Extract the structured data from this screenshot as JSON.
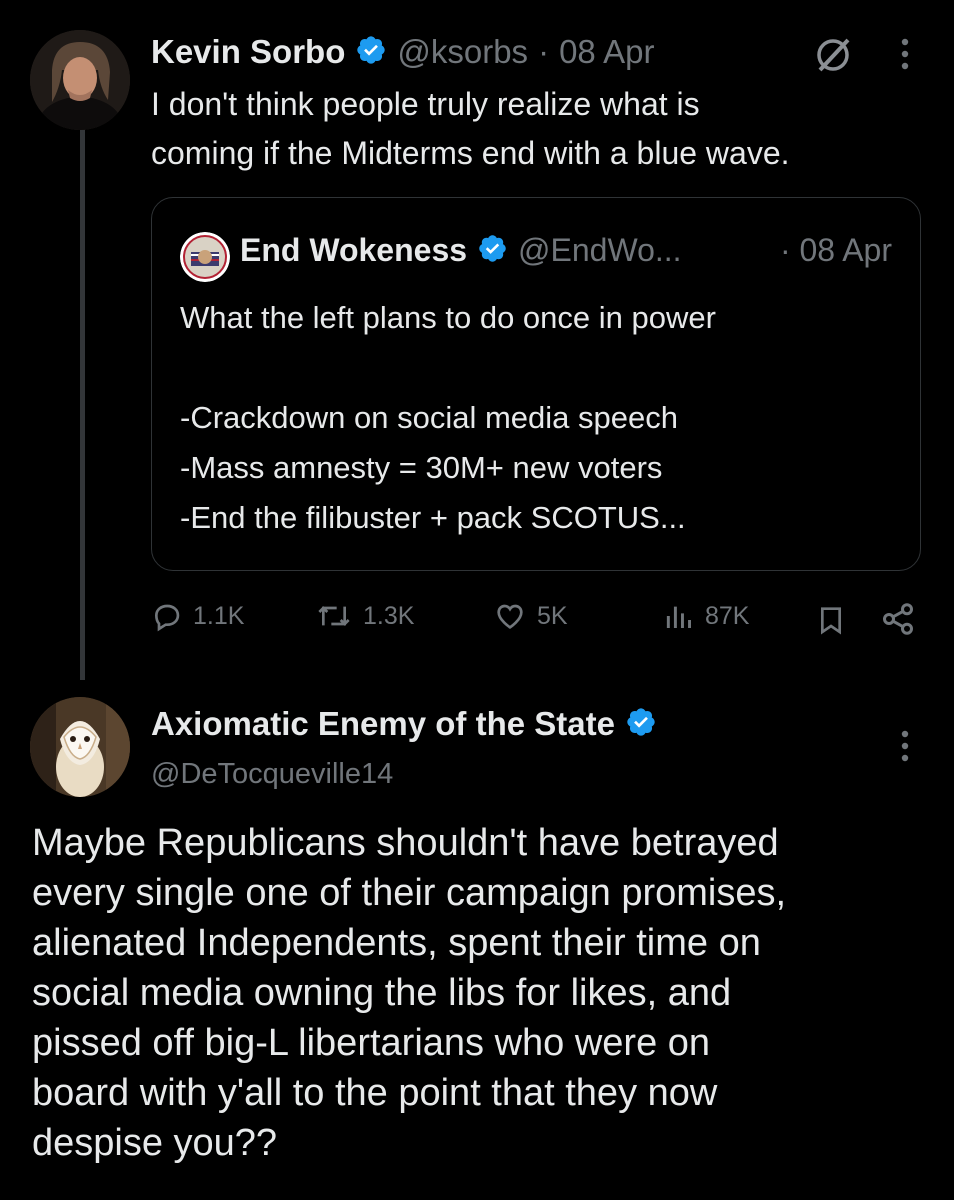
{
  "tweet": {
    "author_name": "Kevin Sorbo",
    "handle": "@ksorbs",
    "separator": "·",
    "date": "08 Apr",
    "text_line1": "I don't think people truly realize what is",
    "text_line2": "coming if the Midterms end with a blue wave.",
    "quote": {
      "author_name": "End Wokeness",
      "handle": "@EndWo...",
      "date": "· 08 Apr",
      "line1": "What the left plans to do once in power",
      "line2": "-Crackdown on social media speech",
      "line3": "-Mass amnesty = 30M+ new voters",
      "line4": "-End the filibuster + pack SCOTUS..."
    },
    "stats": {
      "replies": "1.1K",
      "retweets": "1.3K",
      "likes": "5K",
      "views": "87K"
    }
  },
  "reply": {
    "author_name": "Axiomatic Enemy of the State",
    "handle": "@DeTocqueville14",
    "text_line1": "Maybe Republicans shouldn't have betrayed",
    "text_line2": "every single one of their campaign promises,",
    "text_line3": "alienated Independents, spent their time on",
    "text_line4": "social media owning the libs for likes, and",
    "text_line5": "pissed off big-L libertarians who were on",
    "text_line6": "board with y'all to the point that they now",
    "text_line7": "despise you??"
  },
  "colors": {
    "background": "#000000",
    "text": "#e7e9ea",
    "muted": "#71767b",
    "verified_blue": "#1d9bf0",
    "border": "#2f3336"
  },
  "icons": [
    "verified-badge-icon",
    "grok-icon",
    "more-icon",
    "reply-icon",
    "retweet-icon",
    "like-icon",
    "views-icon",
    "bookmark-icon",
    "share-icon"
  ]
}
